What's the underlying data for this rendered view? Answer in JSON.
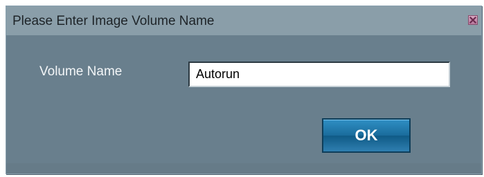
{
  "dialog": {
    "title": "Please Enter Image Volume Name",
    "close_icon": "close-icon",
    "field_label": "Volume Name",
    "field_value": "Autorun",
    "ok_label": "OK"
  },
  "colors": {
    "titlebar": "#8a9ea9",
    "content": "#697f8d",
    "ok_button": "#1a6c9c",
    "close_button": "#c48aab"
  }
}
